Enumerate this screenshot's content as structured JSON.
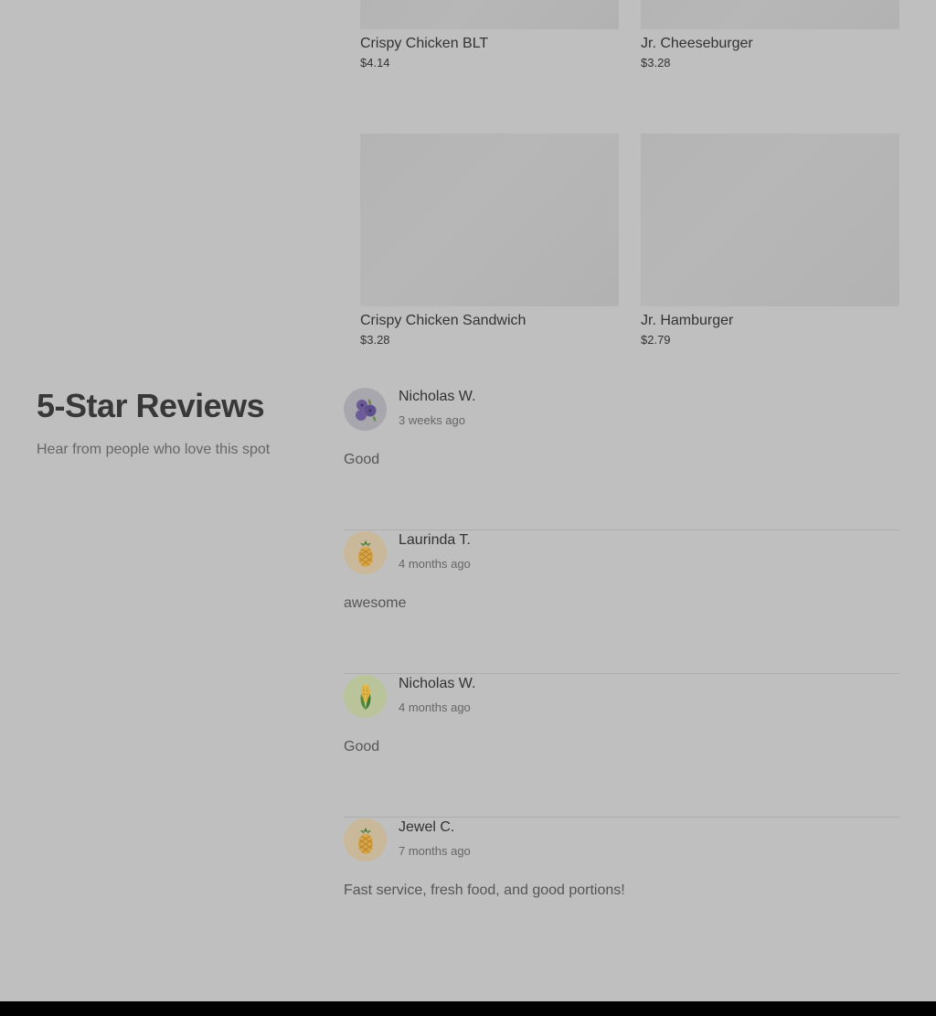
{
  "menu": {
    "items": [
      {
        "name": "Crispy Chicken BLT",
        "price": "$4.14"
      },
      {
        "name": "Jr. Cheeseburger",
        "price": "$3.28"
      },
      {
        "name": "Crispy Chicken Sandwich",
        "price": "$3.28"
      },
      {
        "name": "Jr. Hamburger",
        "price": "$2.79"
      }
    ]
  },
  "reviews": {
    "title": "5-Star Reviews",
    "subtitle": "Hear from people who love this spot",
    "items": [
      {
        "author": "Nicholas W.",
        "time": "3 weeks ago",
        "text": "Good",
        "avatar_icon": "blueberry-icon"
      },
      {
        "author": "Laurinda T.",
        "time": "4 months ago",
        "text": "awesome",
        "avatar_icon": "pineapple-icon"
      },
      {
        "author": "Nicholas W.",
        "time": "4 months ago",
        "text": "Good",
        "avatar_icon": "corn-icon"
      },
      {
        "author": "Jewel C.",
        "time": "7 months ago",
        "text": "Fast service, fresh food, and good portions!",
        "avatar_icon": "pineapple-icon"
      }
    ]
  },
  "colors": {
    "background": "#bfbfbf",
    "text_dark": "#333333",
    "footer": "#000000"
  }
}
